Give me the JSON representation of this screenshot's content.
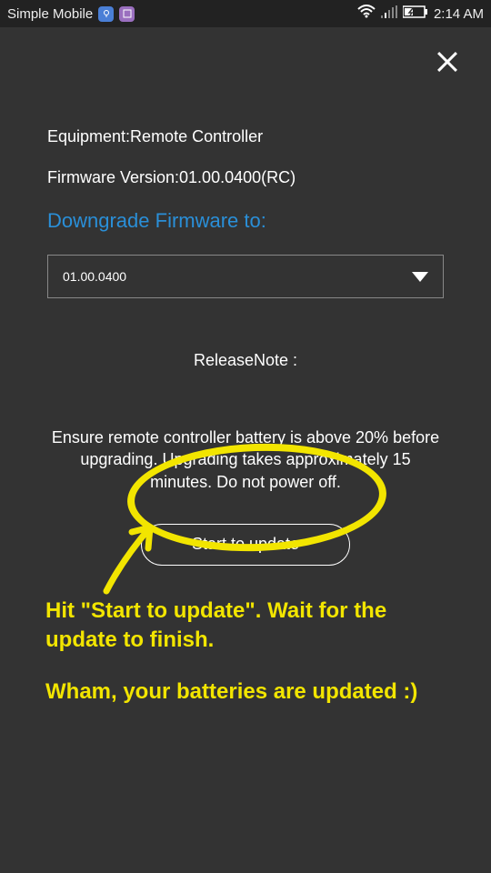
{
  "status_bar": {
    "carrier": "Simple Mobile",
    "time": "2:14 AM"
  },
  "page": {
    "equipment_label": "Equipment:Remote Controller",
    "firmware_label": "Firmware Version:01.00.0400(RC)",
    "section_title": "Downgrade Firmware to:",
    "dropdown_selected": "01.00.0400",
    "release_note_label": "ReleaseNote :",
    "warning": "Ensure remote controller battery is above 20% before upgrading. Upgrading takes approximately 15 minutes. Do not power off.",
    "update_button": "Start to update"
  },
  "annotation": {
    "line1": "Hit \"Start to update\". Wait for the update to finish.",
    "line2": "Wham, your batteries are updated :)"
  }
}
